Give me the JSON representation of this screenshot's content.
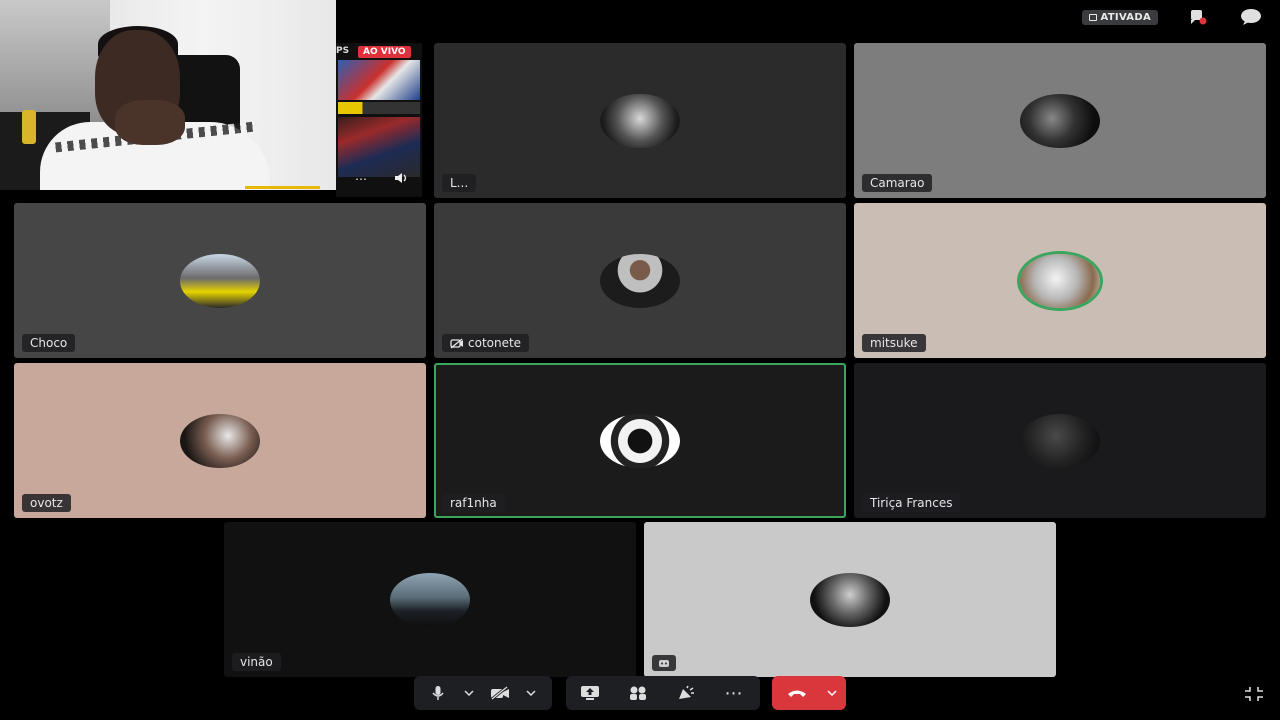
{
  "header": {
    "status_badge": "ATIVADA"
  },
  "stream_preview": {
    "channel_tag": "PS",
    "live_badge": "AO VIVO",
    "more_label": "⋯"
  },
  "tiles": [
    {
      "name": "L...",
      "bg": "#2b2b2b"
    },
    {
      "name": "Camarao",
      "bg": "#7d7d7d"
    },
    {
      "name": "Choco",
      "bg": "#464646"
    },
    {
      "name": "cotonete",
      "bg": "#3a3a3a",
      "muted_video": true
    },
    {
      "name": "mitsuke",
      "bg": "#cabdb3"
    },
    {
      "name": "ovotz",
      "bg": "#c7a89a"
    },
    {
      "name": "raf1nha",
      "bg": "#1b1b1b"
    },
    {
      "name": "Tiriça Frances",
      "bg": "#1a191b"
    },
    {
      "name": "vinão",
      "bg": "#111111"
    },
    {
      "name": "",
      "bg": "#c9c9c9"
    }
  ],
  "controls": {
    "more_label": "⋯"
  },
  "colors": {
    "accent_green": "#3ba55d",
    "hangup_red": "#da373c",
    "bar_bg": "#1e1f22"
  }
}
